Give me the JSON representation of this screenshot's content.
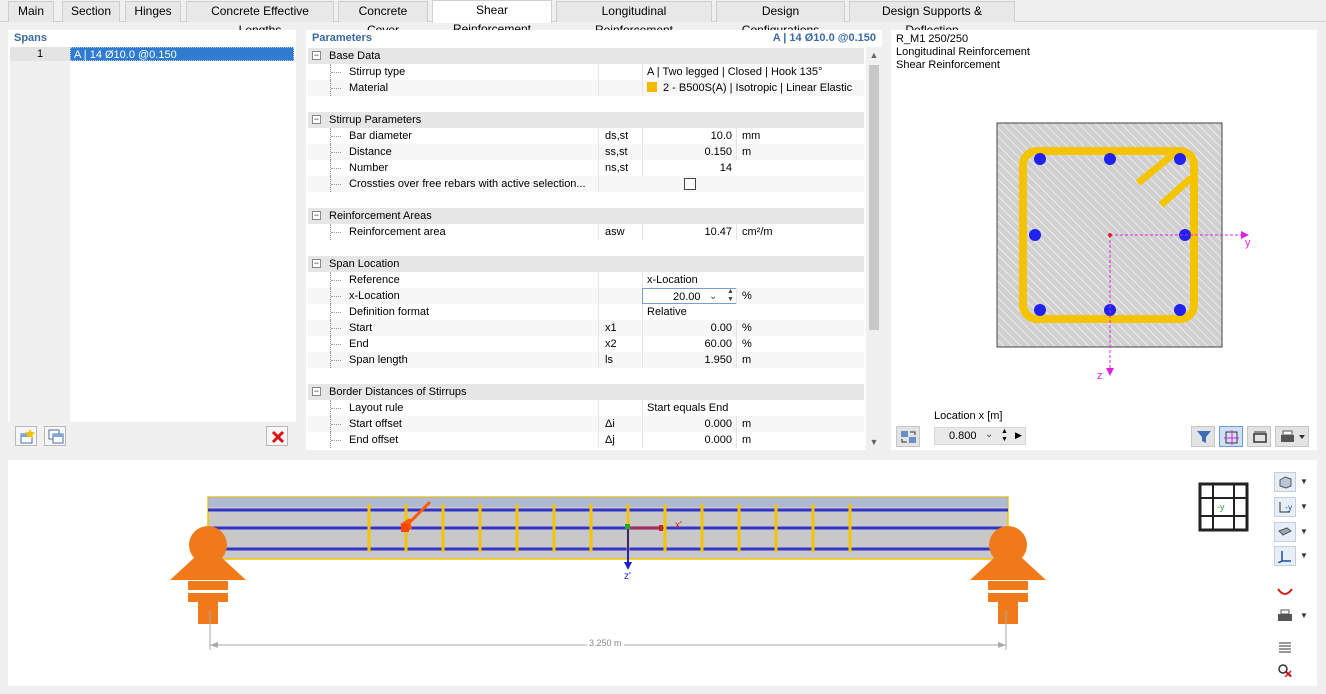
{
  "tabs": [
    {
      "label": "Main",
      "active": false
    },
    {
      "label": "Section",
      "active": false
    },
    {
      "label": "Hinges",
      "active": false
    },
    {
      "label": "Concrete Effective Lengths",
      "active": false
    },
    {
      "label": "Concrete Cover",
      "active": false
    },
    {
      "label": "Shear Reinforcement",
      "active": true
    },
    {
      "label": "Longitudinal Reinforcement",
      "active": false
    },
    {
      "label": "Design Configurations",
      "active": false
    },
    {
      "label": "Design Supports & Deflection",
      "active": false
    }
  ],
  "spans": {
    "title": "Spans",
    "rows": [
      {
        "num": "1",
        "value": "A | 14 Ø10.0 @0.150"
      }
    ]
  },
  "params": {
    "title": "Parameters",
    "title_right": "A | 14 Ø10.0 @0.150",
    "groups": {
      "base": {
        "name": "Base Data",
        "stirrup_type": {
          "name": "Stirrup type",
          "value": "A | Two legged | Closed | Hook 135°"
        },
        "material": {
          "name": "Material",
          "value": "2 - B500S(A) | Isotropic | Linear Elastic",
          "color": "#f5b800"
        }
      },
      "stirrup": {
        "name": "Stirrup Parameters",
        "bar_diameter": {
          "name": "Bar diameter",
          "sym": "ds,st",
          "value": "10.0",
          "unit": "mm"
        },
        "distance": {
          "name": "Distance",
          "sym": "ss,st",
          "value": "0.150",
          "unit": "m"
        },
        "number": {
          "name": "Number",
          "sym": "ns,st",
          "value": "14",
          "unit": ""
        },
        "crossties": {
          "name": "Crossties over free rebars with active selection...",
          "checked": false
        }
      },
      "areas": {
        "name": "Reinforcement Areas",
        "area": {
          "name": "Reinforcement area",
          "sym": "asw",
          "value": "10.47",
          "unit": "cm²/m"
        }
      },
      "span": {
        "name": "Span Location",
        "reference": {
          "name": "Reference",
          "value": "x-Location"
        },
        "xloc": {
          "name": "x-Location",
          "value": "20.00",
          "unit": "%"
        },
        "format": {
          "name": "Definition format",
          "value": "Relative"
        },
        "start": {
          "name": "Start",
          "sym": "x1",
          "value": "0.00",
          "unit": "%"
        },
        "end": {
          "name": "End",
          "sym": "x2",
          "value": "60.00",
          "unit": "%"
        },
        "length": {
          "name": "Span length",
          "sym": "ls",
          "value": "1.950",
          "unit": "m"
        }
      },
      "border": {
        "name": "Border Distances of Stirrups",
        "layout": {
          "name": "Layout rule",
          "value": "Start equals End"
        },
        "start_offset": {
          "name": "Start offset",
          "sym": "Δi",
          "value": "0.000",
          "unit": "m"
        },
        "end_offset": {
          "name": "End offset",
          "sym": "Δj",
          "value": "0.000",
          "unit": "m"
        }
      }
    }
  },
  "preview": {
    "line1": "R_M1 250/250",
    "line2": "Longitudinal Reinforcement",
    "line3": "Shear Reinforcement",
    "axis_y": "y",
    "axis_z": "z",
    "location_label": "Location x [m]",
    "location_value": "0.800"
  },
  "beam": {
    "axis_x": "x'",
    "axis_z": "z'",
    "dimension": "3.250 m",
    "view_label": "-y",
    "colors": {
      "stirrup": "#f5c400",
      "rebar": "#3333cc",
      "support": "#f07a1a",
      "highlight": "#ff4400"
    }
  }
}
